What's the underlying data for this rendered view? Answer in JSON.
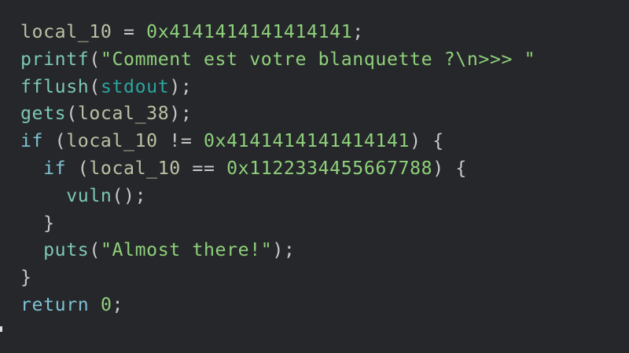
{
  "code": {
    "lines": [
      {
        "indent": "",
        "tokens": [
          {
            "t": "local_10",
            "c": "ident"
          },
          {
            "t": " = ",
            "c": "op"
          },
          {
            "t": "0x4141414141414141",
            "c": "num"
          },
          {
            "t": ";",
            "c": "punct"
          }
        ]
      },
      {
        "indent": "",
        "tokens": [
          {
            "t": "printf",
            "c": "func"
          },
          {
            "t": "(",
            "c": "punct"
          },
          {
            "t": "\"Comment est votre blanquette ?\\n>>> \"",
            "c": "str"
          }
        ]
      },
      {
        "indent": "",
        "tokens": [
          {
            "t": "fflush",
            "c": "func"
          },
          {
            "t": "(",
            "c": "punct"
          },
          {
            "t": "stdout",
            "c": "global"
          },
          {
            "t": ");",
            "c": "punct"
          }
        ]
      },
      {
        "indent": "",
        "tokens": [
          {
            "t": "gets",
            "c": "func"
          },
          {
            "t": "(",
            "c": "punct"
          },
          {
            "t": "local_38",
            "c": "ident"
          },
          {
            "t": ");",
            "c": "punct"
          }
        ]
      },
      {
        "indent": "",
        "tokens": [
          {
            "t": "if",
            "c": "kw"
          },
          {
            "t": " (",
            "c": "punct"
          },
          {
            "t": "local_10",
            "c": "ident"
          },
          {
            "t": " != ",
            "c": "op"
          },
          {
            "t": "0x4141414141414141",
            "c": "num"
          },
          {
            "t": ") {",
            "c": "punct"
          }
        ]
      },
      {
        "indent": "  ",
        "tokens": [
          {
            "t": "if",
            "c": "kw"
          },
          {
            "t": " (",
            "c": "punct"
          },
          {
            "t": "local_10",
            "c": "ident"
          },
          {
            "t": " == ",
            "c": "op"
          },
          {
            "t": "0x1122334455667788",
            "c": "num"
          },
          {
            "t": ") {",
            "c": "punct"
          }
        ]
      },
      {
        "indent": "    ",
        "tokens": [
          {
            "t": "vuln",
            "c": "func"
          },
          {
            "t": "();",
            "c": "punct"
          }
        ]
      },
      {
        "indent": "  ",
        "tokens": [
          {
            "t": "}",
            "c": "punct"
          }
        ]
      },
      {
        "indent": "  ",
        "tokens": [
          {
            "t": "puts",
            "c": "func"
          },
          {
            "t": "(",
            "c": "punct"
          },
          {
            "t": "\"Almost there!\"",
            "c": "str"
          },
          {
            "t": ");",
            "c": "punct"
          }
        ]
      },
      {
        "indent": "",
        "tokens": [
          {
            "t": "}",
            "c": "punct"
          }
        ]
      },
      {
        "indent": "",
        "tokens": [
          {
            "t": "return",
            "c": "kw"
          },
          {
            "t": " ",
            "c": "op"
          },
          {
            "t": "0",
            "c": "num"
          },
          {
            "t": ";",
            "c": "punct"
          }
        ]
      }
    ]
  },
  "colors": {
    "background": "#26272a",
    "identifier": "#b8c2a4",
    "function": "#7cc7b6",
    "global": "#2ca5a0",
    "number": "#8ed07b",
    "string": "#8ed07b",
    "keyword": "#7ec1d4",
    "punctuation": "#c8c8c8"
  }
}
